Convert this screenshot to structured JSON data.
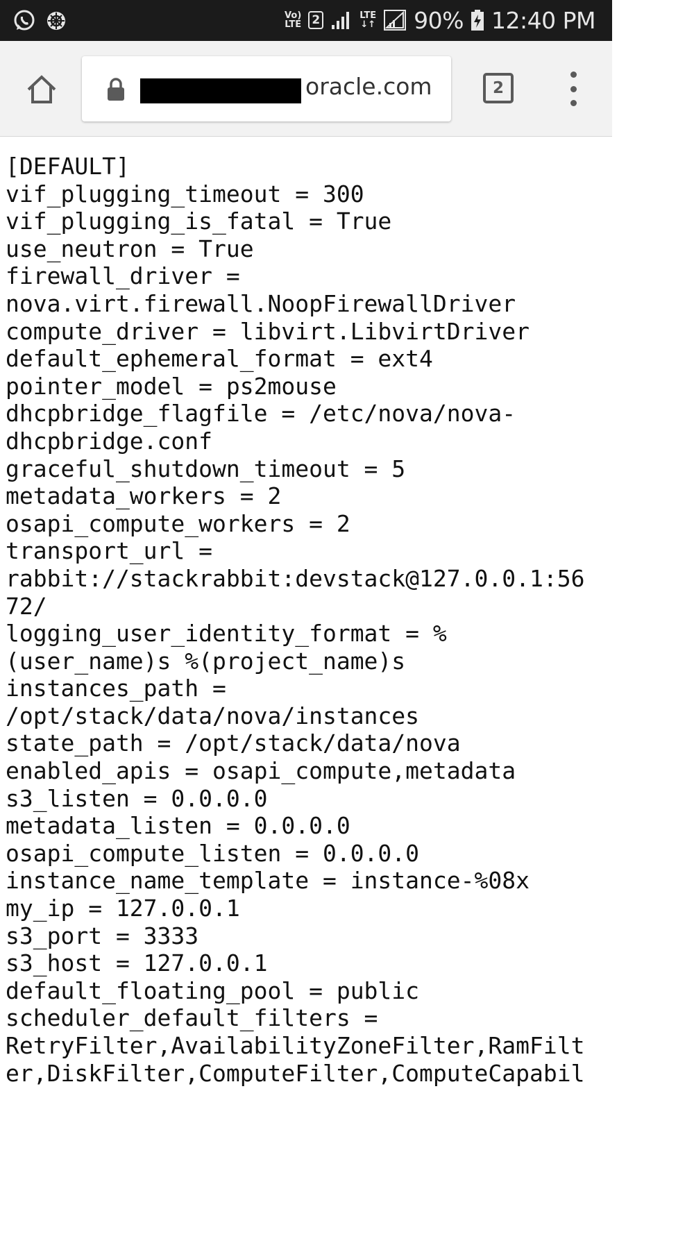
{
  "status_bar": {
    "left_icons": [
      "whatsapp-icon",
      "app-notification-icon"
    ],
    "network_label_top": "Vo)",
    "network_label_bottom": "LTE",
    "sim_slot": "2",
    "data_label": "LTE",
    "battery": "90%",
    "time": "12:40 PM"
  },
  "toolbar": {
    "url_visible": "oracle.com",
    "tab_count": "2"
  },
  "content": {
    "lines": [
      "[DEFAULT]",
      "vif_plugging_timeout = 300",
      "vif_plugging_is_fatal = True",
      "use_neutron = True",
      "firewall_driver =",
      "nova.virt.firewall.NoopFirewallDriver",
      "compute_driver = libvirt.LibvirtDriver",
      "default_ephemeral_format = ext4",
      "pointer_model = ps2mouse",
      "dhcpbridge_flagfile = /etc/nova/nova-",
      "dhcpbridge.conf",
      "graceful_shutdown_timeout = 5",
      "metadata_workers = 2",
      "osapi_compute_workers = 2",
      "transport_url =",
      "rabbit://stackrabbit:devstack@127.0.0.1:56",
      "72/",
      "logging_user_identity_format = %",
      "(user_name)s %(project_name)s",
      "instances_path =",
      "/opt/stack/data/nova/instances",
      "state_path = /opt/stack/data/nova",
      "enabled_apis = osapi_compute,metadata",
      "s3_listen = 0.0.0.0",
      "metadata_listen = 0.0.0.0",
      "osapi_compute_listen = 0.0.0.0",
      "instance_name_template = instance-%08x",
      "my_ip = 127.0.0.1",
      "s3_port = 3333",
      "s3_host = 127.0.0.1",
      "default_floating_pool = public",
      "scheduler_default_filters =",
      "RetryFilter,AvailabilityZoneFilter,RamFilt",
      "er,DiskFilter,ComputeFilter,ComputeCapabil"
    ]
  }
}
